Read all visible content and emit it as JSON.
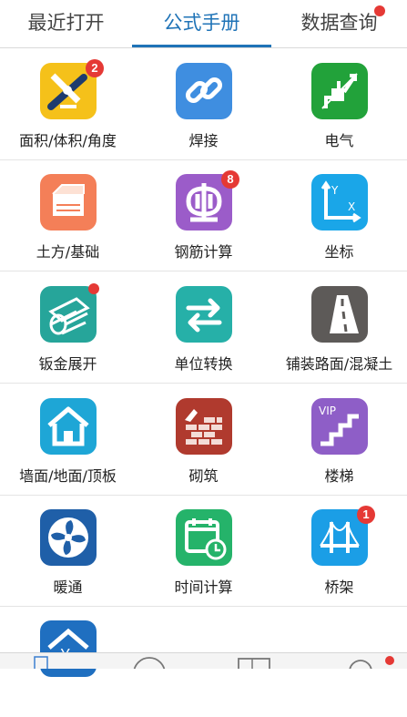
{
  "tabs": [
    {
      "label": "最近打开"
    },
    {
      "label": "公式手册"
    },
    {
      "label": "数据查询"
    }
  ],
  "colors": {
    "accent": "#1f73b7",
    "badge": "#e53935"
  },
  "items": [
    {
      "label": "面积/体积/角度",
      "icon": "ruler-protractor-icon",
      "bg": "#f5c11a",
      "badge": "2"
    },
    {
      "label": "焊接",
      "icon": "chain-link-icon",
      "bg": "#3f8ee0"
    },
    {
      "label": "电气",
      "icon": "electric-plug-icon",
      "bg": "#22a23a"
    },
    {
      "label": "土方/基础",
      "icon": "foundation-icon",
      "bg": "#f47f58"
    },
    {
      "label": "钢筋计算",
      "icon": "rebar-symbol-icon",
      "bg": "#9b5cc9",
      "badge": "8"
    },
    {
      "label": "坐标",
      "icon": "coordinate-axes-icon",
      "bg": "#1aa6e8",
      "axis_y": "Y",
      "axis_x": "X"
    },
    {
      "label": "钣金展开",
      "icon": "sheet-metal-cylinder-icon",
      "bg": "#26a59a",
      "dot": true
    },
    {
      "label": "单位转换",
      "icon": "exchange-arrows-icon",
      "bg": "#26b0a8"
    },
    {
      "label": "铺装路面/混凝土",
      "icon": "road-icon",
      "bg": "#5d5a58"
    },
    {
      "label": "墙面/地面/顶板",
      "icon": "house-icon",
      "bg": "#1ea6d6"
    },
    {
      "label": "砌筑",
      "icon": "brick-wall-icon",
      "bg": "#b03a2e"
    },
    {
      "label": "楼梯",
      "icon": "stairs-icon",
      "bg": "#8e5ec7",
      "vip": "VIP"
    },
    {
      "label": "暖通",
      "icon": "fan-icon",
      "bg": "#1f5fa8"
    },
    {
      "label": "时间计算",
      "icon": "calendar-clock-icon",
      "bg": "#25b36a"
    },
    {
      "label": "桥架",
      "icon": "bridge-icon",
      "bg": "#1b9ee6",
      "badge": "1"
    }
  ],
  "partial_item": {
    "icon": "house-yen-icon",
    "bg": "#1f6fc0",
    "symbol": "¥"
  }
}
